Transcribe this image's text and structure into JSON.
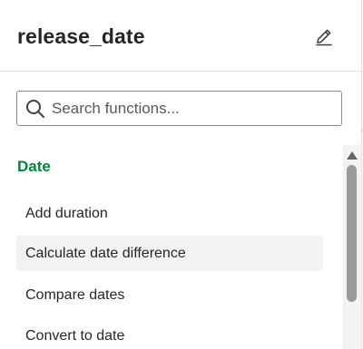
{
  "header": {
    "field_name": "release_date",
    "edit_icon": "pencil-icon"
  },
  "search": {
    "placeholder": "Search functions...",
    "value": "",
    "icon": "search-icon"
  },
  "functions": {
    "category": "Date",
    "items": [
      {
        "label": "Add duration"
      },
      {
        "label": "Calculate date difference"
      },
      {
        "label": "Compare dates"
      },
      {
        "label": "Convert to date"
      }
    ]
  },
  "colors": {
    "category_heading": "#00873d",
    "hover_background": "#f2f2f2",
    "scrollbar_thumb": "#9a9a9a"
  }
}
